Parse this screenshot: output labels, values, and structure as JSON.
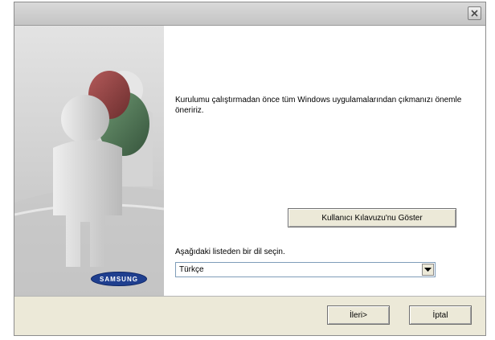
{
  "window": {
    "close_icon": "close-icon"
  },
  "sidebar": {
    "brand_logo_text": "SAMSUNG",
    "illustration": "users-illustration"
  },
  "main": {
    "message": "Kurulumu çalıştırmadan önce tüm Windows uygulamalarından çıkmanızı önemle öneririz.",
    "guide_button_label": "Kullanıcı Kılavuzu'nu Göster",
    "language_label": "Aşağıdaki listeden bir dil seçin.",
    "language_selected": "Türkçe"
  },
  "footer": {
    "next_label": "İleri>",
    "cancel_label": "İptal"
  },
  "colors": {
    "window_bg": "#ece9d8",
    "content_bg": "#ffffff",
    "logo_blue": "#1f3f8f"
  }
}
